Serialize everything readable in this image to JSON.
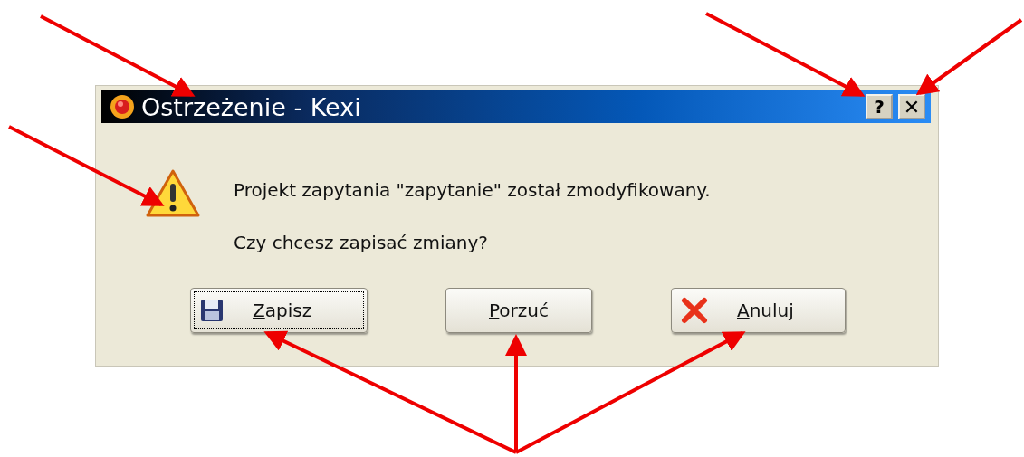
{
  "window": {
    "title": "Ostrzeżenie - Kexi",
    "title_buttons": [
      {
        "kind": "help",
        "label": "?"
      },
      {
        "kind": "close",
        "label": "✕"
      }
    ]
  },
  "message": {
    "lines": [
      "Projekt zapytania \"zapytanie\" został zmodyfikowany.",
      "Czy chcesz zapisać zmiany?"
    ]
  },
  "buttons": [
    {
      "label": "Zapisz",
      "kind": "save",
      "focused": true,
      "underline_first": true
    },
    {
      "label": "Porzuć",
      "kind": "plain",
      "focused": false,
      "underline_first": true
    },
    {
      "label": "Anuluj",
      "kind": "cancel",
      "focused": false,
      "underline_first": true
    }
  ]
}
